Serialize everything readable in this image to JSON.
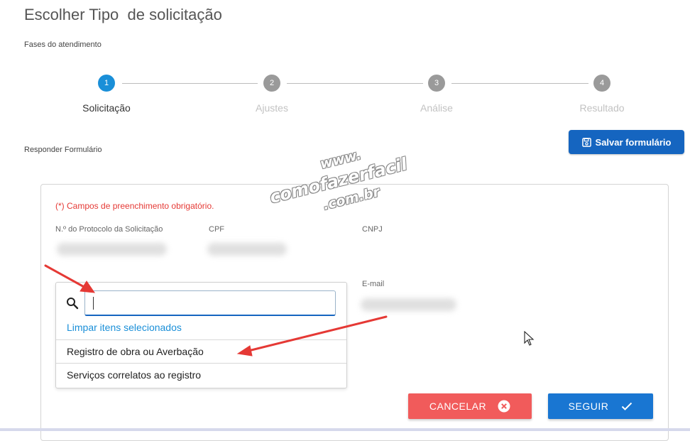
{
  "page": {
    "title": "Escolher Tipo  de solicitação",
    "phases_label": "Fases do atendimento",
    "respond_label": "Responder Formulário"
  },
  "steps": [
    {
      "number": "1",
      "label": "Solicitação",
      "active": true
    },
    {
      "number": "2",
      "label": "Ajustes",
      "active": false
    },
    {
      "number": "3",
      "label": "Análise",
      "active": false
    },
    {
      "number": "4",
      "label": "Resultado",
      "active": false
    }
  ],
  "toolbar": {
    "save_label": "Salvar formulário",
    "save_icon": "floppy-disk-icon"
  },
  "form": {
    "required_note": "(*) Campos de preenchimento obrigatório.",
    "fields": {
      "protocol_label": "N.º do Protocolo da Solicitação",
      "cpf_label": "CPF",
      "cnpj_label": "CNPJ",
      "email_label": "E-mail"
    },
    "dropdown": {
      "search_value": "",
      "clear_label": "Limpar itens selecionados",
      "options": [
        "Registro de obra ou Averbação",
        "Serviços correlatos ao registro"
      ]
    }
  },
  "actions": {
    "cancel_label": "CANCELAR",
    "next_label": "SEGUIR"
  },
  "watermark": {
    "line1": "www.",
    "line2": "comofazerfacil",
    "line3": ".com.br"
  },
  "colors": {
    "primary": "#1565c0",
    "accent": "#1a8fd8",
    "danger": "#f15b5b",
    "required": "#e53935",
    "annotation": "#e53935"
  }
}
